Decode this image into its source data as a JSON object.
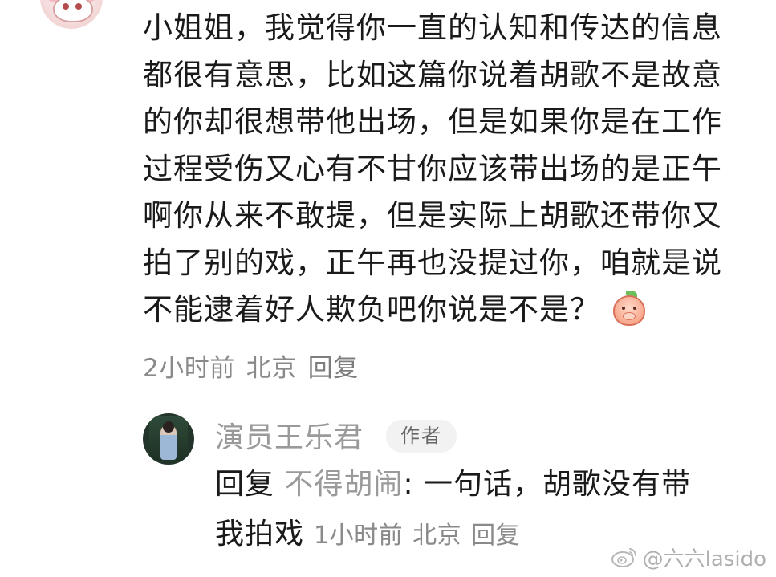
{
  "comment": {
    "lines": [
      "小姐姐，我觉得你一直的认知和传达的信息",
      "都很有意思，比如这篇你说着胡歌不是故意",
      "的你却很想带他出场，但是如果你是在工作",
      "过程受伤又心有不甘你应该带出场的是正午",
      "啊你从来不敢提，但是实际上胡歌还带你又",
      "拍了别的戏，正午再也没提过你，咱就是说",
      "不能逮着好人欺负吧你说是不是？"
    ],
    "emoji": "peach-covering-mouth-emoji",
    "time": "2小时前",
    "location": "北京",
    "reply_label": "回复"
  },
  "reply": {
    "author": "演员王乐君",
    "badge": "作者",
    "prefix": "回复",
    "target": "不得胡闹",
    "text_line1": ": 一句话，胡歌没有带",
    "text_line2": "我拍戏",
    "time": "1小时前",
    "location": "北京",
    "reply_label": "回复"
  },
  "watermark": {
    "text": "@六六lasido",
    "icon": "weibo-logo-icon"
  }
}
